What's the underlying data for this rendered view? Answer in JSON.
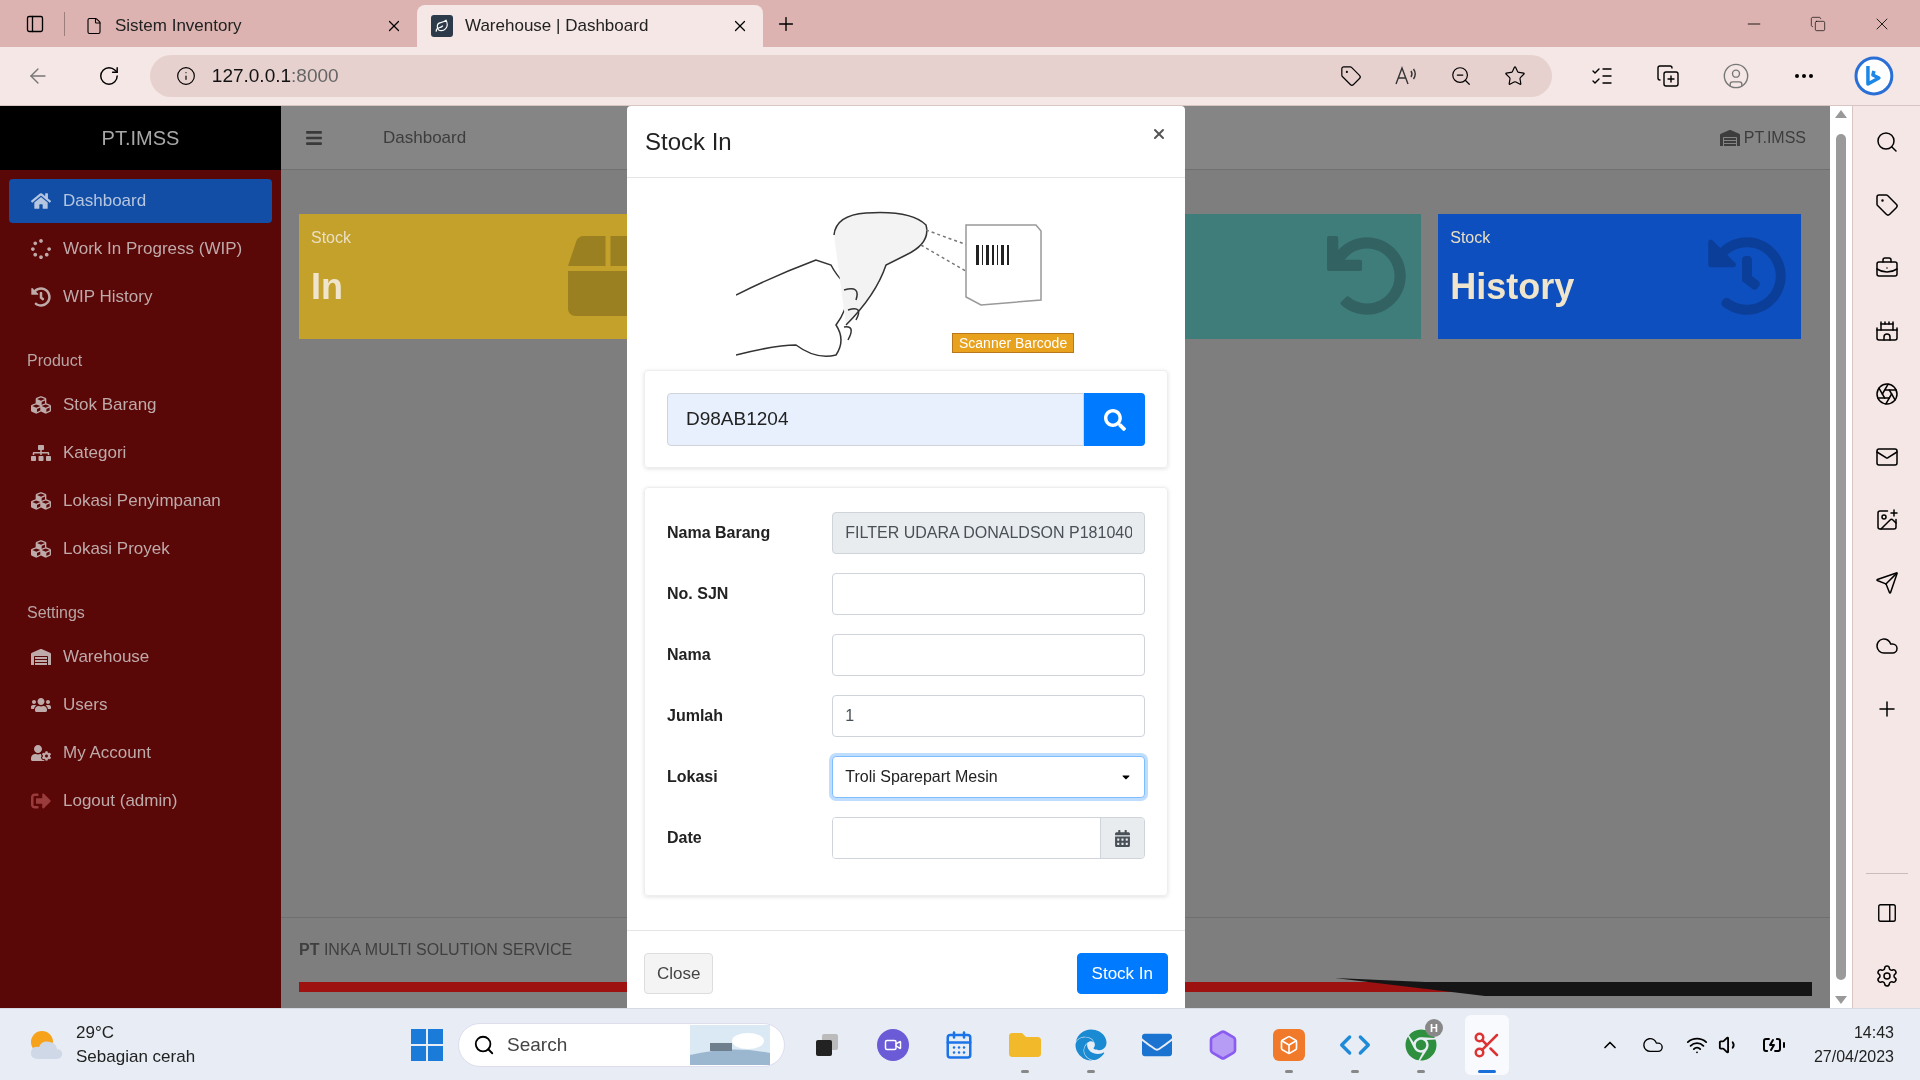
{
  "browser": {
    "tabs": [
      {
        "title": "Sistem Inventory",
        "selected": false
      },
      {
        "title": "Warehouse | Dashboard",
        "selected": true
      }
    ],
    "url": {
      "host": "127.0.0.1",
      "rest": ":8000"
    }
  },
  "sidebar": {
    "brand": "PT.IMSS",
    "sections": [
      {
        "items": [
          {
            "label": "Dashboard",
            "selected": true
          },
          {
            "label": "Work In Progress (WIP)",
            "selected": false
          },
          {
            "label": "WIP History",
            "selected": false
          }
        ]
      },
      {
        "heading": "Product",
        "items": [
          {
            "label": "Stok Barang",
            "selected": false
          },
          {
            "label": "Kategori",
            "selected": false
          },
          {
            "label": "Lokasi Penyimpanan",
            "selected": false
          },
          {
            "label": "Lokasi Proyek",
            "selected": false
          }
        ]
      },
      {
        "heading": "Settings",
        "items": [
          {
            "label": "Warehouse",
            "selected": false
          },
          {
            "label": "Users",
            "selected": false
          },
          {
            "label": "My Account",
            "selected": false
          },
          {
            "label": "Logout (admin)",
            "selected": false
          }
        ]
      }
    ]
  },
  "header": {
    "title": "Dashboard",
    "company": "PT.IMSS"
  },
  "cards": [
    {
      "caption": "Stock",
      "title": "In",
      "color": "#c3a12a"
    },
    {
      "color": "#3f7d7b"
    },
    {
      "caption": "Stock",
      "title": "History",
      "color": "#0e4fc0"
    }
  ],
  "footer": {
    "text": "**PT** INKA MULTI SOLUTION SERVICE"
  },
  "modal": {
    "title": "Stock In",
    "image_label": "Scanner Barcode",
    "search": {
      "value": "D98AB1204"
    },
    "fields": [
      {
        "label": "Nama Barang",
        "kind": "readonly",
        "value": "FILTER UDARA DONALDSON P181040",
        "focused": false
      },
      {
        "label": "No. SJN",
        "kind": "text",
        "focused": false
      },
      {
        "label": "Nama",
        "kind": "text",
        "focused": false
      },
      {
        "label": "Jumlah",
        "kind": "text",
        "value": "1",
        "focused": false
      },
      {
        "label": "Lokasi",
        "kind": "select",
        "value": "Troli Sparepart Mesin",
        "focused": true
      },
      {
        "label": "Date",
        "kind": "date",
        "focused": false
      }
    ],
    "buttons": [
      {
        "label": "Close",
        "kind": "secondary"
      },
      {
        "label": "Stock In",
        "kind": "primary"
      }
    ]
  },
  "taskbar": {
    "weather": {
      "temp": "29°C",
      "desc": "Sebagian cerah"
    },
    "search": {
      "placeholder": "Search"
    },
    "apps": [
      {
        "running": false,
        "active": false
      },
      {
        "running": false,
        "active": false
      },
      {
        "running": false,
        "active": false
      },
      {
        "running": true,
        "active": false
      },
      {
        "running": true,
        "active": false
      },
      {
        "running": false,
        "active": false
      },
      {
        "running": false,
        "active": false
      },
      {
        "running": true,
        "active": false
      },
      {
        "running": true,
        "active": false
      },
      {
        "running": true,
        "active": false,
        "badge": "H"
      },
      {
        "running": true,
        "active": true
      }
    ],
    "clock": {
      "time": "14:43",
      "date": "27/04/2023"
    }
  }
}
